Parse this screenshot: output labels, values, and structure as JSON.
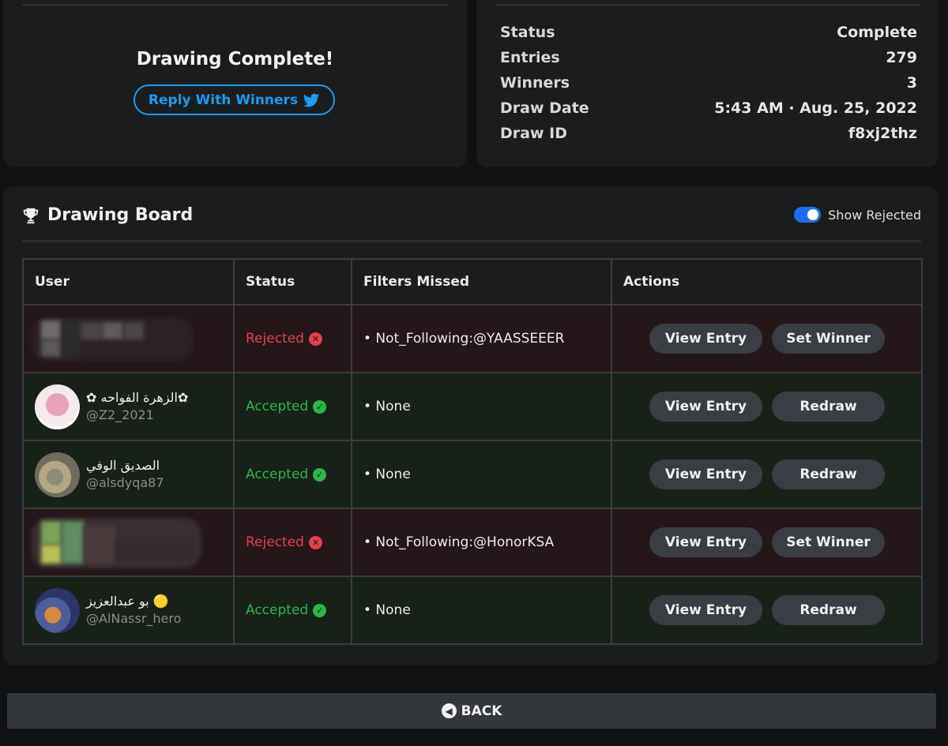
{
  "summary": {
    "title": "Drawing Complete!",
    "reply_label": "Reply With Winners"
  },
  "stats": [
    {
      "label": "Status",
      "value": "Complete"
    },
    {
      "label": "Entries",
      "value": "279"
    },
    {
      "label": "Winners",
      "value": "3"
    },
    {
      "label": "Draw Date",
      "value": "5:43 AM · Aug. 25, 2022"
    },
    {
      "label": "Draw ID",
      "value": "f8xj2thz"
    }
  ],
  "board": {
    "title": "Drawing Board",
    "toggle_label": "Show Rejected",
    "columns": [
      "User",
      "Status",
      "Filters Missed",
      "Actions"
    ],
    "rows": [
      {
        "name": "",
        "handle": "",
        "status": "Rejected",
        "filter": "• Not_Following:@YAASSEEER",
        "action1": "View Entry",
        "action2": "Set Winner"
      },
      {
        "name": "✿ الزهرة الفواحه✿",
        "handle": "@Z2_2021",
        "status": "Accepted",
        "filter": "• None",
        "action1": "View Entry",
        "action2": "Redraw"
      },
      {
        "name": "الصديق الوفي",
        "handle": "@alsdyqa87",
        "status": "Accepted",
        "filter": "• None",
        "action1": "View Entry",
        "action2": "Redraw"
      },
      {
        "name": "",
        "handle": "",
        "status": "Rejected",
        "filter": "• Not_Following:@HonorKSA",
        "action1": "View Entry",
        "action2": "Set Winner"
      },
      {
        "name": "بو عبدالعزيز 🟡",
        "handle": "@AlNassr_hero",
        "status": "Accepted",
        "filter": "• None",
        "action1": "View Entry",
        "action2": "Redraw"
      }
    ]
  },
  "back_label": "BACK",
  "colors": {
    "accent_twitter": "#1d9bf0",
    "rejected": "#e0414d",
    "accepted": "#2fb34b",
    "toggle_on": "#1b6ef3"
  },
  "icons": [
    "twitter-bird-icon",
    "trophy-icon",
    "x-circle-icon",
    "check-circle-icon",
    "arrow-left-circle-icon"
  ]
}
